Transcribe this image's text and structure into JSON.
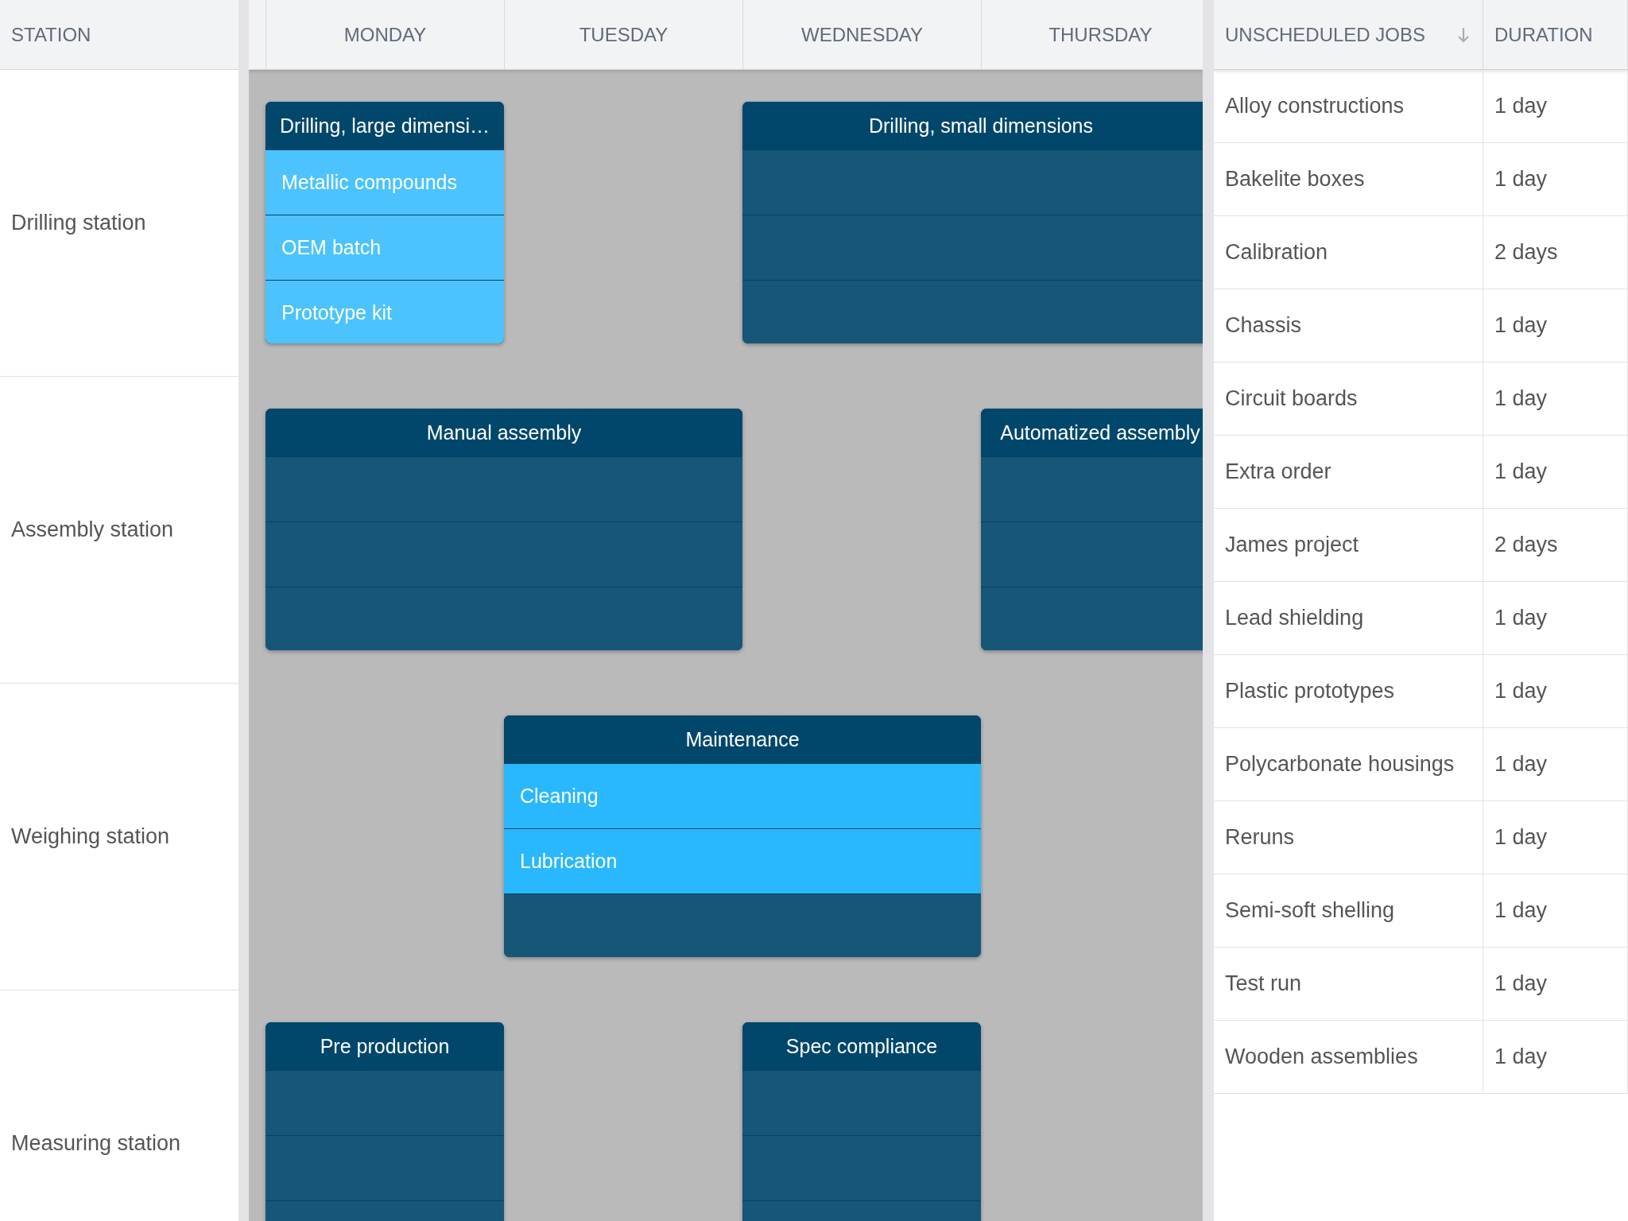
{
  "station_header": "STATION",
  "days": [
    "MONDAY",
    "TUESDAY",
    "WEDNESDAY",
    "THURSDAY"
  ],
  "stations": [
    {
      "name": "Drilling station",
      "timeline": [
        {
          "kind": "event",
          "title": "Drilling, large dimensi…",
          "tasks": [
            {
              "kind": "task",
              "label": "Metallic compounds",
              "color": "#4cc3fd"
            },
            {
              "kind": "task",
              "label": "OEM batch",
              "color": "#4cc3fd"
            },
            {
              "kind": "task",
              "label": "Prototype kit",
              "color": "#4cc3fd"
            }
          ]
        },
        {
          "kind": "empty"
        },
        {
          "kind": "event",
          "title": "Drilling, small dimensions",
          "tasks": [
            {
              "kind": "empty"
            },
            {
              "kind": "empty"
            },
            {
              "kind": "empty"
            }
          ]
        },
        {
          "kind": "continued"
        }
      ]
    },
    {
      "name": "Assembly station",
      "timeline": [
        {
          "kind": "event",
          "title": "Manual assembly",
          "tasks": [
            {
              "kind": "empty"
            },
            {
              "kind": "empty"
            },
            {
              "kind": "empty"
            }
          ]
        },
        {
          "kind": "continued"
        },
        {
          "kind": "empty"
        },
        {
          "kind": "event",
          "title": "Automatized assembly",
          "tasks": [
            {
              "kind": "empty"
            },
            {
              "kind": "empty"
            },
            {
              "kind": "empty"
            }
          ]
        }
      ]
    },
    {
      "name": "Weighing station",
      "timeline": [
        {
          "kind": "empty"
        },
        {
          "kind": "event",
          "title": "Maintenance",
          "tasks": [
            {
              "kind": "task",
              "label": "Cleaning",
              "color": "#29b8fe"
            },
            {
              "kind": "task",
              "label": "Lubrication",
              "color": "#29b8fe"
            },
            {
              "kind": "empty"
            }
          ]
        },
        {
          "kind": "continued"
        },
        {
          "kind": "empty"
        }
      ]
    },
    {
      "name": "Measuring station",
      "timeline": [
        {
          "kind": "event",
          "title": "Pre production",
          "tasks": [
            {
              "kind": "empty"
            },
            {
              "kind": "empty"
            },
            {
              "kind": "empty"
            }
          ]
        },
        {
          "kind": "empty"
        },
        {
          "kind": "event",
          "title": "Spec compliance",
          "tasks": [
            {
              "kind": "empty"
            },
            {
              "kind": "empty"
            },
            {
              "kind": "empty"
            }
          ]
        },
        {
          "kind": "empty"
        }
      ]
    }
  ],
  "jobs_table": {
    "columns": [
      {
        "label": "UNSCHEDULED JOBS",
        "sorted": true
      },
      {
        "label": "DURATION",
        "sorted": false
      }
    ],
    "rows": [
      [
        "Alloy constructions",
        "1 day"
      ],
      [
        "Bakelite boxes",
        "1 day"
      ],
      [
        "Calibration",
        "2 days"
      ],
      [
        "Chassis",
        "1 day"
      ],
      [
        "Circuit boards",
        "1 day"
      ],
      [
        "Extra order",
        "1 day"
      ],
      [
        "James project",
        "2 days"
      ],
      [
        "Lead shielding",
        "1 day"
      ],
      [
        "Plastic prototypes",
        "1 day"
      ],
      [
        "Polycarbonate housings",
        "1 day"
      ],
      [
        "Reruns",
        "1 day"
      ],
      [
        "Semi-soft shelling",
        "1 day"
      ],
      [
        "Test run",
        "1 day"
      ],
      [
        "Wooden assemblies",
        "1 day"
      ]
    ]
  }
}
